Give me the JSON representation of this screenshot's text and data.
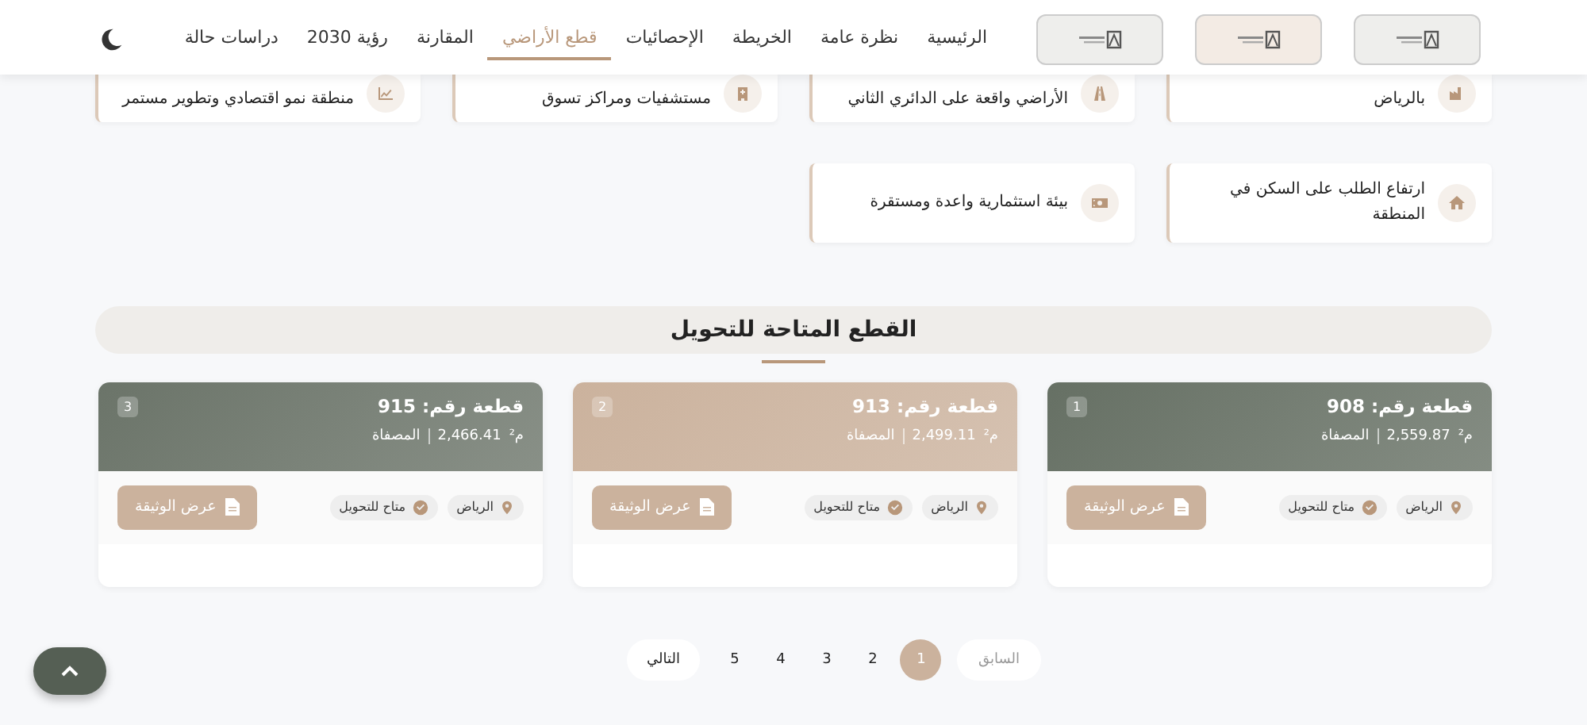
{
  "nav": {
    "logos": [
      {
        "kind": "logo"
      },
      {
        "kind": "logo"
      },
      {
        "kind": "logo"
      }
    ],
    "items": [
      {
        "label": "الرئيسية",
        "selected": false
      },
      {
        "label": "نظرة عامة",
        "selected": false
      },
      {
        "label": "الخريطة",
        "selected": false
      },
      {
        "label": "الإحصائيات",
        "selected": false
      },
      {
        "label": "قطع الأراضي",
        "selected": true
      },
      {
        "label": "المقارنة",
        "selected": false
      },
      {
        "label": "رؤية 2030",
        "selected": false
      },
      {
        "label": "دراسات حالة",
        "selected": false
      }
    ]
  },
  "features": [
    {
      "kind": "factory",
      "text": "بالرياض"
    },
    {
      "kind": "road",
      "text": "الأراضي واقعة على الدائري الثاني"
    },
    {
      "kind": "hospital",
      "text": "مستشفيات ومراكز تسوق"
    },
    {
      "kind": "chart",
      "text": "منطقة نمو اقتصادي وتطوير مستمر"
    },
    {
      "kind": "house",
      "text": "ارتفاع الطلب على السكن في المنطقة"
    },
    {
      "kind": "money",
      "text": "بيئة استثمارية واعدة ومستقرة"
    }
  ],
  "section_title": "القطع المتاحة للتحويل",
  "plots": [
    {
      "title": "قطعة رقم: 908",
      "number": "1",
      "area": "2,559.87",
      "unit": "م²",
      "area_label": "المصفاة",
      "color": "#667064",
      "city": "الرياض",
      "status": "متاح للتحويل",
      "button": "عرض الوثيقة"
    },
    {
      "title": "قطعة رقم: 913",
      "number": "2",
      "area": "2,499.11",
      "unit": "م²",
      "area_label": "المصفاة",
      "color": "#cbb29d",
      "city": "الرياض",
      "status": "متاح للتحويل",
      "button": "عرض الوثيقة"
    },
    {
      "title": "قطعة رقم: 915",
      "number": "3",
      "area": "2,466.41",
      "unit": "م²",
      "area_label": "المصفاة",
      "color": "#6b7469",
      "city": "الرياض",
      "status": "متاح للتحويل",
      "button": "عرض الوثيقة"
    }
  ],
  "pagination": {
    "prev": "السابق",
    "next": "التالي",
    "pages": [
      {
        "label": "1",
        "selected": true
      },
      {
        "label": "2",
        "selected": false
      },
      {
        "label": "3",
        "selected": false
      },
      {
        "label": "4",
        "selected": false
      },
      {
        "label": "5",
        "selected": false
      }
    ]
  }
}
